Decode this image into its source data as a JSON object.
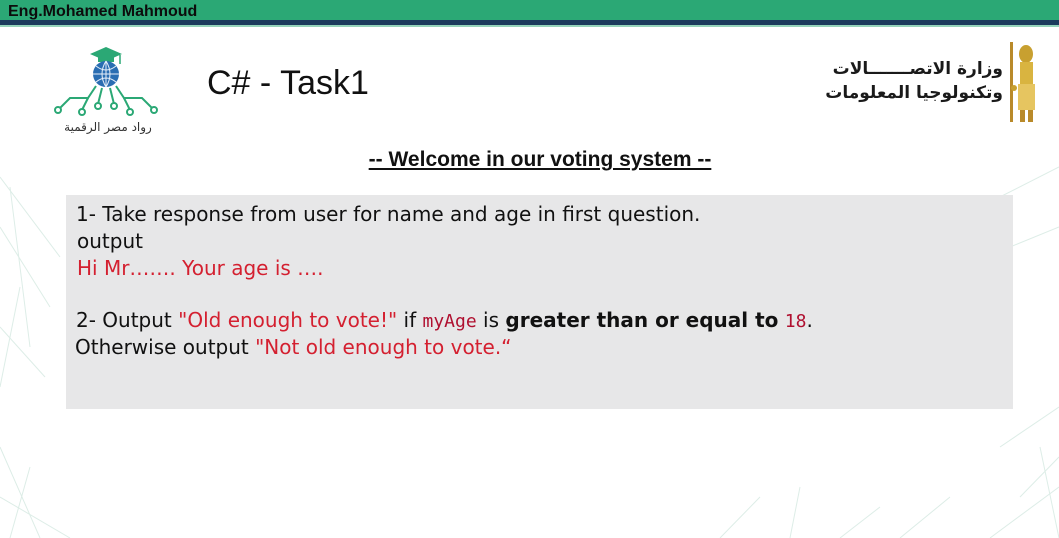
{
  "header": {
    "author": "Eng.Mohamed Mahmoud"
  },
  "logo_left": {
    "caption": "رواد مصر الرقمية",
    "icon": "graduation-cap-globe-circuit-icon"
  },
  "logo_right": {
    "line1": "وزارة الاتصـــــــالات",
    "line2": "وتكنولوجيا المعلومات",
    "icon": "pharaonic-figure-icon"
  },
  "slide": {
    "title": "C# - Task1",
    "welcome": "-- Welcome in our voting system --"
  },
  "task": {
    "q1_line": "1- Take response from user for name and age in first question.",
    "q1_output_label": "output",
    "q1_output_example": "Hi Mr……. Your age is ….",
    "q2_prefix": "2- Output ",
    "q2_msg_true": "\"Old enough to vote!\"",
    "q2_if": " if ",
    "q2_var": "myAge",
    "q2_is": " is ",
    "q2_condition": "greater than or equal to",
    "q2_space": " ",
    "q2_value": "18",
    "q2_period": ".",
    "q3_prefix": "Otherwise output ",
    "q3_msg_false": "\"Not old enough to vote.“"
  },
  "colors": {
    "accent_green": "#2ba875",
    "accent_navy": "#1b3a5c",
    "highlight_red": "#d42030",
    "box_gray": "#e7e7e8"
  }
}
